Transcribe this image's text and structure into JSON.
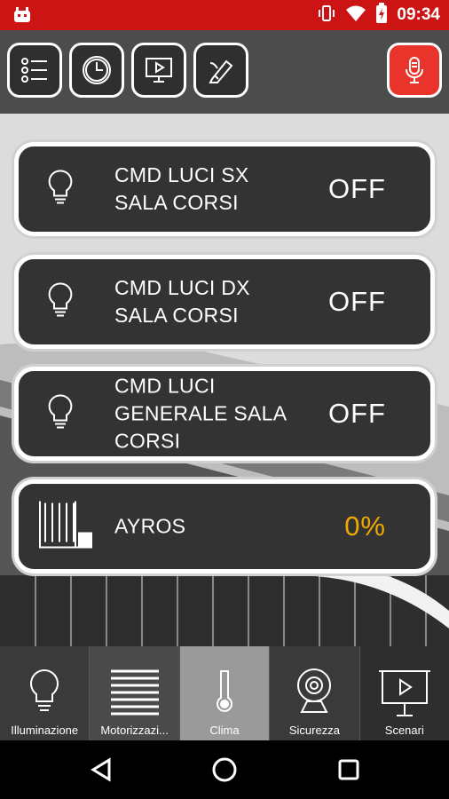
{
  "status_bar": {
    "time": "09:34"
  },
  "toolbar": {
    "buttons": [
      {
        "name": "list-menu",
        "icon": "list-icon"
      },
      {
        "name": "clock",
        "icon": "clock-icon"
      },
      {
        "name": "scenario-player",
        "icon": "presentation-play-icon"
      },
      {
        "name": "edit",
        "icon": "edit-pen-icon"
      }
    ],
    "mic_icon": "microphone-icon"
  },
  "cards": [
    {
      "label": "CMD LUCI SX SALA CORSI",
      "state": "OFF",
      "icon": "lightbulb-icon"
    },
    {
      "label": "CMD LUCI DX SALA CORSI",
      "state": "OFF",
      "icon": "lightbulb-icon"
    },
    {
      "label": "CMD LUCI GENERALE SALA CORSI",
      "state": "OFF",
      "icon": "lightbulb-icon"
    },
    {
      "label": "AYROS",
      "state": "0%",
      "icon": "window-blind-icon"
    }
  ],
  "colors": {
    "status_bar": "#cc1414",
    "accent": "#f2a900",
    "mic": "#e8342b",
    "card": "#333333"
  },
  "bottom_nav": {
    "items": [
      {
        "label": "Illuminazione",
        "icon": "lightbulb-icon"
      },
      {
        "label": "Motorizzazi...",
        "icon": "blinds-icon"
      },
      {
        "label": "Clima",
        "icon": "thermometer-icon"
      },
      {
        "label": "Sicurezza",
        "icon": "webcam-icon"
      },
      {
        "label": "Scenari",
        "icon": "presentation-play-icon"
      }
    ],
    "selected": "Clima"
  }
}
